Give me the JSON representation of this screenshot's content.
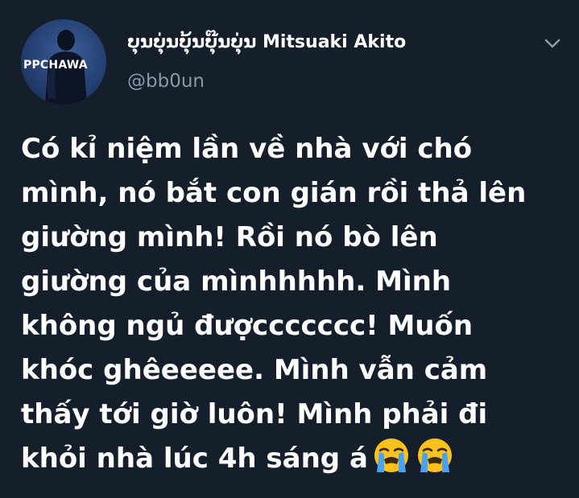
{
  "tweet": {
    "avatar_text": "PPCHAWA",
    "display_name": "ບຸນບຸ່ນບຸ້ນບຸ໊ນບຸ່ນ Mitsuaki Akito",
    "handle": "@bb0un",
    "body": "Có kỉ niệm lần về nhà với chó\nmình, nó bắt con gián rồi thả lên\ngiường mình! Rồi nó bò lên\ngiường của mìnhhhhh. Mình\nkhông ngủ đượccccccc! Muốn\nkhóc ghêeeeee. Mình vẫn cảm\nthấy tới giờ luôn! Mình phải đi\nkhỏi nhà lúc 4h sáng á",
    "emojis": [
      "loudly-crying-face-icon",
      "loudly-crying-face-icon"
    ]
  },
  "colors": {
    "background": "#151f2c",
    "text": "#ffffff",
    "secondary_text": "#8899a6",
    "emoji_yellow": "#fcc21b",
    "tears_blue": "#4aa3f0"
  }
}
